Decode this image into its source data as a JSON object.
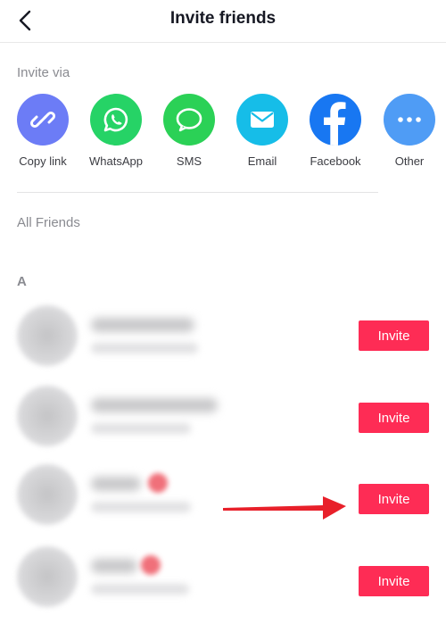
{
  "header": {
    "title": "Invite friends",
    "back_icon": "chevron-left-icon"
  },
  "invite_via": {
    "label": "Invite via",
    "options": [
      {
        "label": "Copy link",
        "icon": "link-icon",
        "color": "#6c7cf6"
      },
      {
        "label": "WhatsApp",
        "icon": "whatsapp-icon",
        "color": "#26d366"
      },
      {
        "label": "SMS",
        "icon": "sms-bubble-icon",
        "color": "#2bd156"
      },
      {
        "label": "Email",
        "icon": "envelope-icon",
        "color": "#16bde8"
      },
      {
        "label": "Facebook",
        "icon": "facebook-icon",
        "color": "#1877f2"
      },
      {
        "label": "Other",
        "icon": "more-dots-icon",
        "color": "#4f9cf5"
      }
    ]
  },
  "friends": {
    "label": "All Friends",
    "section_letter": "A",
    "rows": [
      {
        "invite_label": "Invite"
      },
      {
        "invite_label": "Invite"
      },
      {
        "invite_label": "Invite"
      },
      {
        "invite_label": "Invite"
      }
    ]
  },
  "colors": {
    "accent": "#fe2c55",
    "arrow": "#e8202a"
  }
}
